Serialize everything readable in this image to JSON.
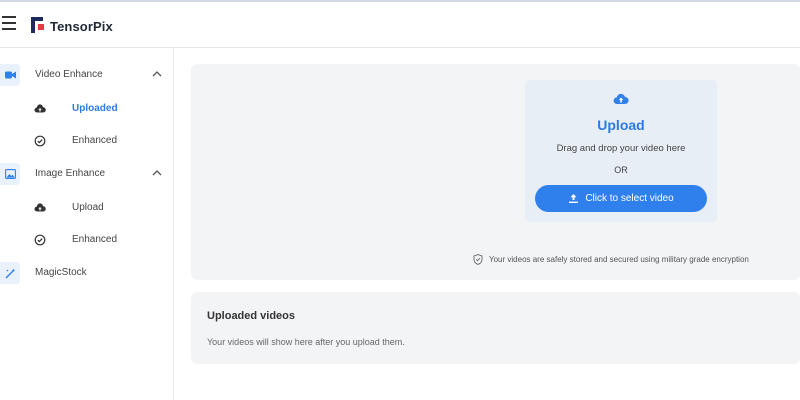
{
  "app": {
    "brand": "TensorPix"
  },
  "sidebar": {
    "sections": [
      {
        "label": "Video Enhance",
        "icon": "video-camera-icon",
        "items": [
          {
            "label": "Uploaded",
            "icon": "cloud-upload-icon",
            "active": true
          },
          {
            "label": "Enhanced",
            "icon": "check-circle-icon",
            "active": false
          }
        ]
      },
      {
        "label": "Image Enhance",
        "icon": "image-icon",
        "items": [
          {
            "label": "Upload",
            "icon": "cloud-upload-icon",
            "active": false
          },
          {
            "label": "Enhanced",
            "icon": "check-circle-icon",
            "active": false
          }
        ]
      },
      {
        "label": "MagicStock",
        "icon": "magic-wand-icon",
        "items": []
      }
    ]
  },
  "upload": {
    "title": "Upload",
    "subtitle": "Drag and drop your video here",
    "or_text": "OR",
    "button_label": "Click to select video",
    "security_note": "Your videos are safely stored and secured using military grade encryption"
  },
  "videos": {
    "title": "Uploaded videos",
    "empty_message": "Your videos will show here after you upload them."
  },
  "colors": {
    "accent": "#2f80ed",
    "accent_text": "#2c7be5",
    "panel_bg": "#f3f4f6",
    "dropzone_bg": "#e8eef6",
    "logo_red": "#e63946",
    "logo_navy": "#1e2a5a"
  }
}
